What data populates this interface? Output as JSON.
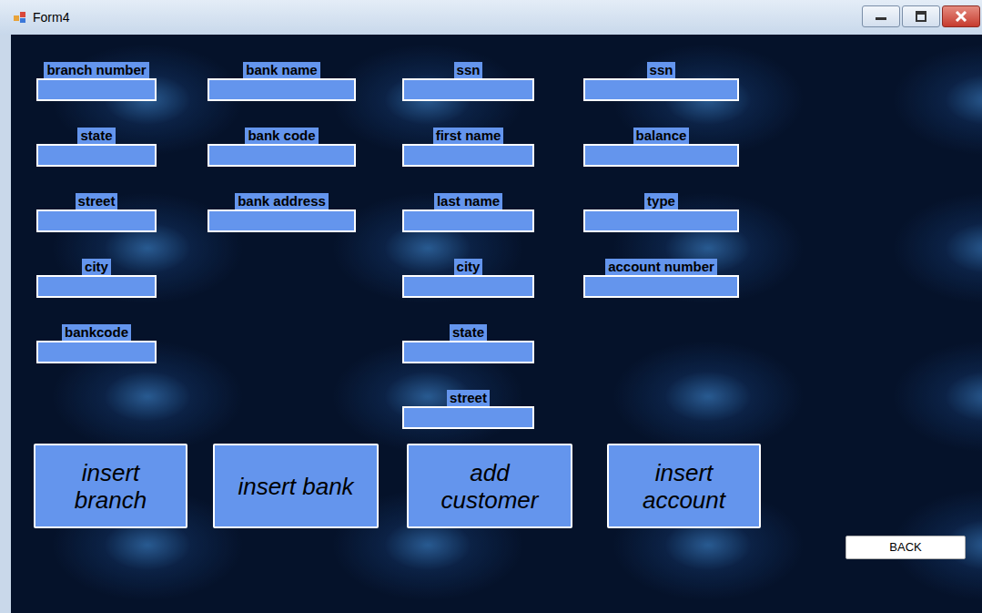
{
  "window": {
    "title": "Form4"
  },
  "groups": [
    {
      "fields": [
        {
          "label": "branch number"
        },
        {
          "label": "state"
        },
        {
          "label": "street"
        },
        {
          "label": "city"
        },
        {
          "label": "bankcode"
        }
      ]
    },
    {
      "fields": [
        {
          "label": "bank name"
        },
        {
          "label": "bank code"
        },
        {
          "label": "bank address"
        }
      ]
    },
    {
      "fields": [
        {
          "label": "ssn"
        },
        {
          "label": "first name"
        },
        {
          "label": "last name"
        },
        {
          "label": "city"
        },
        {
          "label": "state"
        },
        {
          "label": "street"
        }
      ]
    },
    {
      "fields": [
        {
          "label": "ssn"
        },
        {
          "label": "balance"
        },
        {
          "label": "type"
        },
        {
          "label": "account number"
        }
      ]
    }
  ],
  "actions": [
    "insert branch",
    "insert bank",
    "add customer",
    "insert account"
  ],
  "back_button": "BACK"
}
